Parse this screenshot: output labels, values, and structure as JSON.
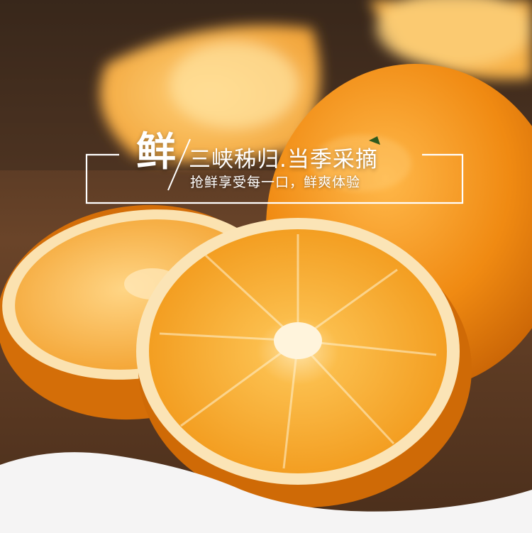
{
  "banner": {
    "big_char": "鲜",
    "headline": "三峡秭归.当季采摘",
    "subline": "抢鲜享受每一口，鲜爽体验"
  },
  "colors": {
    "orange_peel": "#f08a12",
    "orange_flesh": "#f7a52a",
    "pith": "#fbe6b8",
    "wood": "#6b4326",
    "frame_line": "#ffffff",
    "bottom_wave": "#f5f4f4"
  }
}
